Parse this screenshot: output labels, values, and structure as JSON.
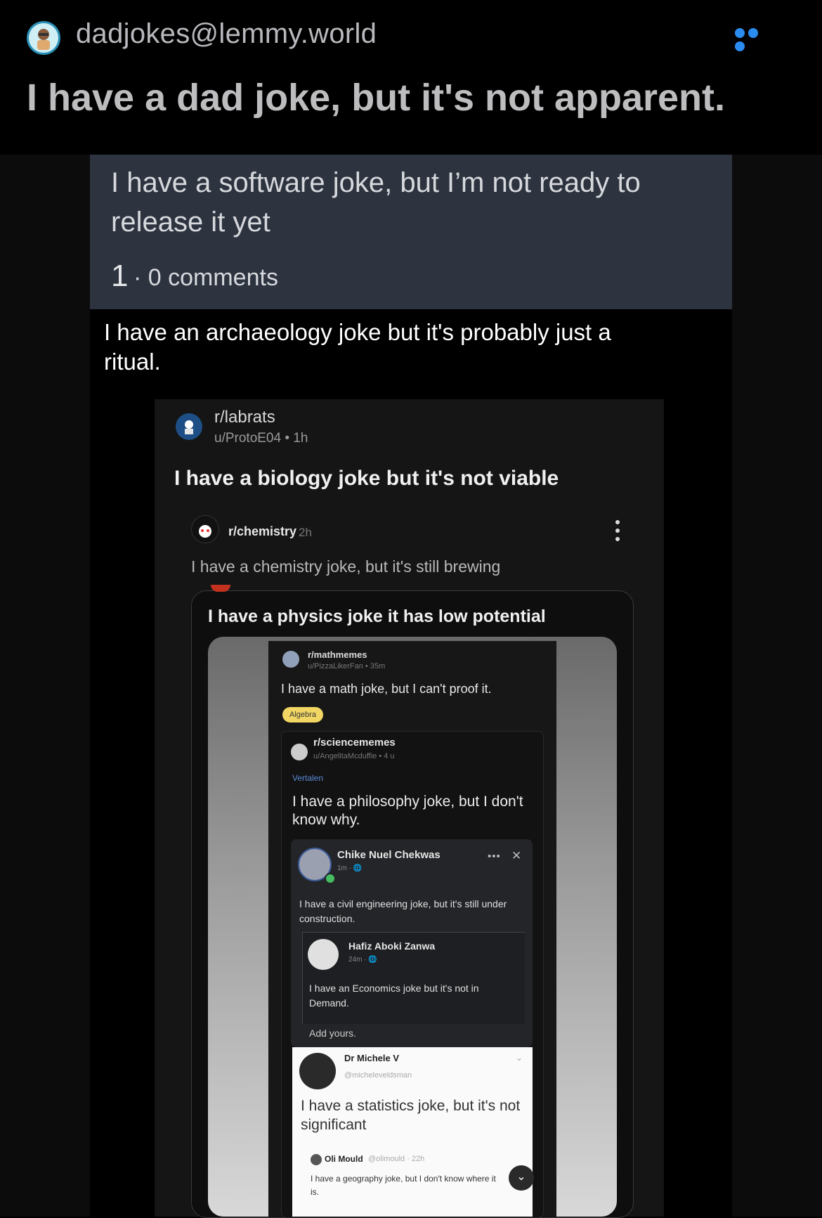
{
  "header": {
    "community": "dadjokes@lemmy.world",
    "title": "I have a dad joke, but it's not apparent.",
    "more_icon": "ellipsis-icon",
    "accent_color": "#2b8cf0"
  },
  "software_post": {
    "text": "I have a software joke, but I’m not ready to release it yet",
    "score": "1",
    "comments": "· 0 comments"
  },
  "archaeology_text": "I have an archaeology joke but it's probably just a ritual.",
  "labrats": {
    "subreddit": "r/labrats",
    "user": "u/ProtoE04 • 1h",
    "title": "I have a biology joke but it's not viable"
  },
  "chemistry": {
    "subreddit": "r/chemistry",
    "time": "2h",
    "text": "I have a chemistry joke, but it's still brewing"
  },
  "physics": {
    "title": "I have a physics joke it has low potential"
  },
  "mathmemes": {
    "subreddit": "r/mathmemes",
    "user": "u/PizzaLikerFan • 35m",
    "text": "I have a math joke, but I can't proof it.",
    "flair": "Algebra"
  },
  "sciencememes": {
    "subreddit": "r/sciencememes",
    "user": "u/AngelitaMcduffie • 4 u",
    "translate": "Vertalen",
    "text": "I have a philosophy joke, but I don't know why."
  },
  "facebook": {
    "name": "Chike Nuel Chekwas",
    "meta": "1m · 🌐",
    "dots": "•••",
    "close": "✕",
    "text": "I have a civil engineering joke, but it's still under construction."
  },
  "facebook_reply": {
    "name": "Hafiz Aboki Zanwa",
    "meta": "24m · 🌐",
    "text": "I have an Economics joke but it's not in Demand.",
    "add": "Add yours."
  },
  "tweet": {
    "name": "Dr Michele V",
    "handle": "@micheleveldsman",
    "text": "I have a statistics joke, but it's not significant",
    "chevron": "⌄"
  },
  "tweet_reply": {
    "name": "Oli Mould",
    "meta": "@olimould · 22h",
    "text": "I have a geography joke, but I don't know where it is."
  }
}
